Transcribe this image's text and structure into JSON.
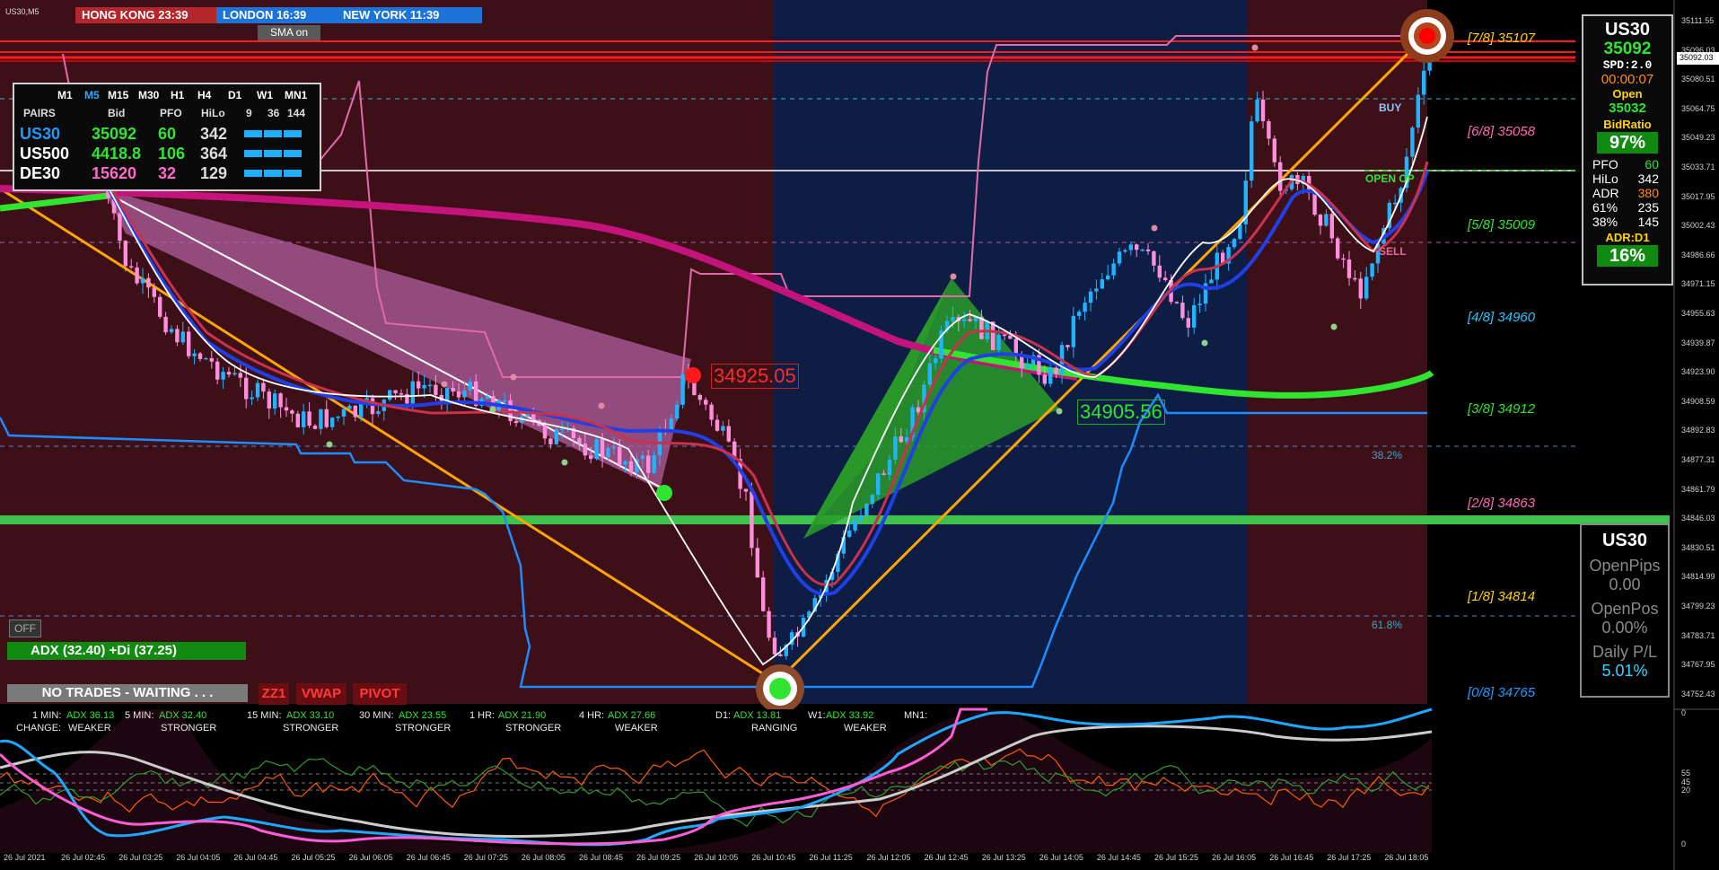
{
  "symbol_caption": "US30,M5",
  "timezones": [
    {
      "label": "HONG KONG  23:39",
      "color": "#b3262b"
    },
    {
      "label": "LONDON  16:39",
      "color": "#1e73d8"
    },
    {
      "label": "NEW YORK  11:39",
      "color": "#1e73d8"
    }
  ],
  "sma_button": "SMA on",
  "pairs_panel": {
    "timeframes": [
      "M1",
      "M5",
      "M15",
      "M30",
      "H1",
      "H4",
      "D1",
      "W1",
      "MN1"
    ],
    "active_timeframe": "M5",
    "headers": [
      "PAIRS",
      "Bid",
      "PFO",
      "HiLo",
      "9",
      "36",
      "144"
    ],
    "rows": [
      {
        "pair": "US30",
        "bid": "35092",
        "pfo": "60",
        "hilo": "342",
        "pair_color": "#1e9bff",
        "bid_color": "#2fe52f",
        "pfo_color": "#2fe52f"
      },
      {
        "pair": "US500",
        "bid": "4418.8",
        "pfo": "106",
        "hilo": "364",
        "pair_color": "#ffffff",
        "bid_color": "#2fe52f",
        "pfo_color": "#2fe52f"
      },
      {
        "pair": "DE30",
        "bid": "15620",
        "pfo": "32",
        "hilo": "129",
        "pair_color": "#ffffff",
        "bid_color": "#ff69c8",
        "pfo_color": "#ff69c8"
      }
    ]
  },
  "price_tags": {
    "high": "34925.05",
    "low": "34905.56"
  },
  "fib_labels": {
    "f382": "38.2%",
    "f618": "61.8%"
  },
  "chart_words": {
    "buy": "BUY",
    "sell": "SELL",
    "open": "OPEN OP"
  },
  "murrey": [
    {
      "label": "[7/8]   35107",
      "color": "#ffd400"
    },
    {
      "label": "[6/8]   35058",
      "color": "#ff69b4"
    },
    {
      "label": "[5/8]   35009",
      "color": "#2fe52f"
    },
    {
      "label": "[4/8]   34960",
      "color": "#29c9ff"
    },
    {
      "label": "[3/8]   34912",
      "color": "#2fe52f"
    },
    {
      "label": "[2/8]   34863",
      "color": "#ff69b4"
    },
    {
      "label": "[1/8]   34814",
      "color": "#ffd400"
    },
    {
      "label": "[0/8]   34765",
      "color": "#1e9bff"
    }
  ],
  "price_axis": [
    "35111.55",
    "35096.03",
    "35080.51",
    "35064.75",
    "35049.23",
    "35033.71",
    "35017.95",
    "35002.43",
    "34986.66",
    "34971.15",
    "34955.63",
    "34939.87",
    "34923.90",
    "34908.59",
    "34892.83",
    "34877.31",
    "34861.79",
    "34846.03",
    "34830.51",
    "34814.99",
    "34799.23",
    "34783.71",
    "34767.95",
    "34752.43"
  ],
  "current_price_tag": "35092.03",
  "info_panel": {
    "symbol": "US30",
    "price": "35092",
    "spread": "SPD:2.0",
    "timer": "00:00:07",
    "open_label": "Open",
    "open_value": "35032",
    "bidratio_label": "BidRatio",
    "bidratio_value": "97%",
    "stats": [
      {
        "k": "PFO",
        "v": "60",
        "c": "#2fe52f"
      },
      {
        "k": "HiLo",
        "v": "342",
        "c": "#ffffff"
      },
      {
        "k": "ADR",
        "v": "380",
        "c": "#ff8c1a"
      },
      {
        "k": "61%",
        "v": "235",
        "c": "#ffffff"
      },
      {
        "k": "38%",
        "v": "145",
        "c": "#ffffff"
      }
    ],
    "adr_label": "ADR:D1",
    "adr_value": "16%"
  },
  "pl_panel": {
    "symbol": "US30",
    "open_pips_label": "OpenPips",
    "open_pips_value": "0.00",
    "open_pos_label": "OpenPos",
    "open_pos_value": "0.00%",
    "daily_label": "Daily P/L",
    "daily_value": "5.01%"
  },
  "buttons": {
    "off": "OFF",
    "adx_status": "ADX (32.40)   +Di (37.25)",
    "no_trades": "NO TRADES - WAITING . . .",
    "zz1": "ZZ1",
    "vwap": "VWAP",
    "pivot": "PIVOT"
  },
  "adx_strip": [
    {
      "tf": "1 MIN:",
      "val": "ADX 36.13",
      "state": "WEAKER"
    },
    {
      "tf": "5 MIN:",
      "val": "ADX 32.40",
      "state": "STRONGER"
    },
    {
      "tf": "15 MIN:",
      "val": "ADX 33.10",
      "state": "STRONGER"
    },
    {
      "tf": "30 MIN:",
      "val": "ADX 23.55",
      "state": "STRONGER"
    },
    {
      "tf": "1 HR:",
      "val": "ADX 21.90",
      "state": "STRONGER"
    },
    {
      "tf": "4 HR:",
      "val": "ADX 27.66",
      "state": "WEAKER"
    },
    {
      "tf": "D1:",
      "val": "ADX 13.81",
      "state": "RANGING"
    },
    {
      "tf": "W1:",
      "val": "ADX 33.92",
      "state": "WEAKER"
    },
    {
      "tf": "MN1:",
      "val": "",
      "state": ""
    }
  ],
  "change_label": "CHANGE:",
  "oscillator_axis": [
    "0",
    "55",
    "45",
    "20",
    "0"
  ],
  "time_axis": [
    "26 Jul 2021",
    "26 Jul 02:45",
    "26 Jul 03:25",
    "26 Jul 04:05",
    "26 Jul 04:45",
    "26 Jul 05:25",
    "26 Jul 06:05",
    "26 Jul 06:45",
    "26 Jul 07:25",
    "26 Jul 08:05",
    "26 Jul 08:45",
    "26 Jul 09:25",
    "26 Jul 10:05",
    "26 Jul 10:45",
    "26 Jul 11:25",
    "26 Jul 12:05",
    "26 Jul 12:45",
    "26 Jul 13:25",
    "26 Jul 14:05",
    "26 Jul 14:45",
    "26 Jul 15:25",
    "26 Jul 16:05",
    "26 Jul 16:45",
    "26 Jul 17:25",
    "26 Jul 18:05"
  ]
}
